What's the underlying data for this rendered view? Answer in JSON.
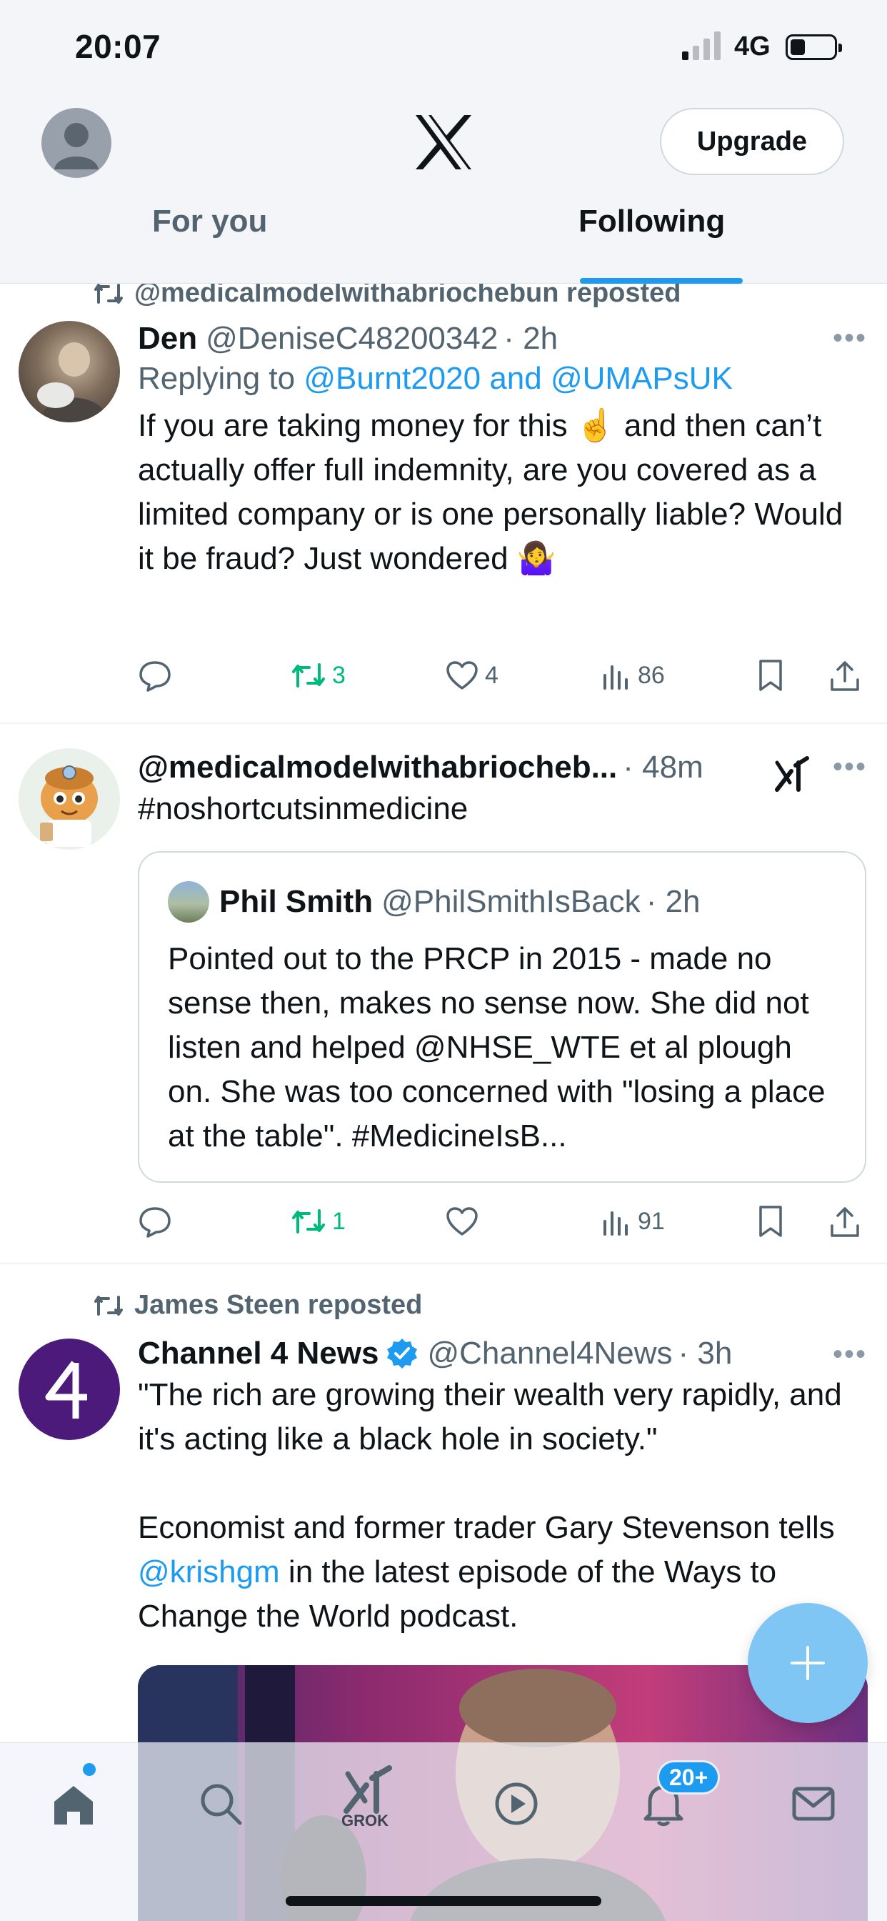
{
  "status_bar": {
    "time": "20:07",
    "network": "4G",
    "battery_level": 0.35
  },
  "header": {
    "upgrade_label": "Upgrade"
  },
  "tabs": [
    {
      "label": "For you",
      "active": false
    },
    {
      "label": "Following",
      "active": true
    }
  ],
  "posts": [
    {
      "social_context": "@medicalmodelwithabriochebun reposted",
      "name": "Den",
      "handle": "@DeniseC48200342",
      "time": "· 2h",
      "replying_prefix": "Replying to",
      "replying_to": "@Burnt2020 and @UMAPsUK",
      "text": "If you are taking money for this ☝️ and then can’t actually offer full indemnity, are you covered as a limited company or is one personally liable? Would it be fraud? Just wondered 🤷‍♀️",
      "reposts": "3",
      "likes": "4",
      "views": "86"
    },
    {
      "name": "@medicalmodelwithabriocheb...",
      "time": "· 48m",
      "text": "#noshortcutsinmedicine",
      "quote": {
        "name": "Phil Smith",
        "handle": "@PhilSmithIsBack",
        "time": "· 2h",
        "text": "Pointed out to the PRCP in 2015 - made no sense then, makes no sense now.  She did not listen and helped @NHSE_WTE et al plough on. She was too concerned with \"losing a place at the table\". #MedicineIsB..."
      },
      "reposts": "1",
      "views": "91"
    },
    {
      "social_context": "James Steen reposted",
      "name": "Channel 4 News",
      "handle": "@Channel4News",
      "time": "· 3h",
      "text_line1": "\"The rich are growing their wealth very rapidly, and it's acting like a black hole in society.\"",
      "text_pre_link": "Economist and former trader Gary Stevenson tells ",
      "text_link": "@krishgm",
      "text_post_link": " in the latest episode of the Ways to Change the World podcast."
    }
  ],
  "bottom_nav": {
    "grok_label": "GROK",
    "notifications_badge": "20+",
    "items": [
      "home-icon",
      "search-icon",
      "grok-icon",
      "video-icon",
      "bell-icon",
      "mail-icon"
    ]
  },
  "colors": {
    "accent": "#1d9bf0",
    "repost_green": "#00ba7c",
    "secondary_text": "#536471"
  }
}
